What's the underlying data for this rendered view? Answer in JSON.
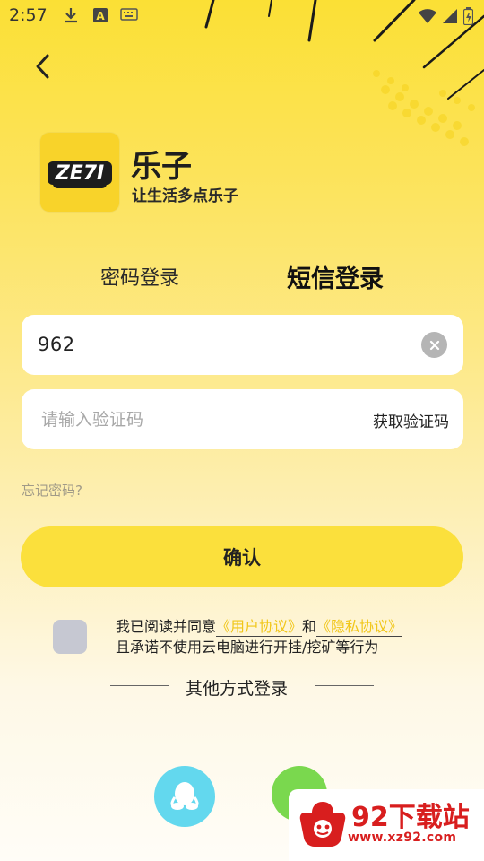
{
  "status_bar": {
    "time": "2:57",
    "icons": [
      "download-icon",
      "a-notification-icon",
      "keyboard-icon",
      "wifi-icon",
      "signal-icon",
      "battery-icon"
    ]
  },
  "header": {
    "back_icon": "back-arrow-icon"
  },
  "app": {
    "logo_text": "ZE7I",
    "name": "乐子",
    "slogan": "让生活多点乐子"
  },
  "tabs": [
    {
      "label": "密码登录",
      "active": false
    },
    {
      "label": "短信登录",
      "active": true
    }
  ],
  "phone": {
    "value": "962",
    "clear_icon": "clear-icon"
  },
  "code": {
    "placeholder": "请输入验证码",
    "get_code_label": "获取验证码"
  },
  "forgot_label": "忘记密码?",
  "confirm_label": "确认",
  "agreement": {
    "prefix": "我已阅读并同意",
    "user_agreement": "《用户协议》",
    "and": "和",
    "privacy_agreement": "《隐私协议》",
    "suffix": "且承诺不使用云电脑进行开挂/挖矿等行为"
  },
  "other_login": {
    "title": "其他方式登录",
    "providers": [
      "qq-icon",
      "wechat-icon"
    ]
  },
  "watermark": {
    "title": "92下载站",
    "url": "www.xz92.com"
  },
  "colors": {
    "brand_yellow": "#fbe03c",
    "link_yellow": "#f1c618",
    "qq_blue": "#63d8ee",
    "wechat_green": "#7ad84e",
    "watermark_red": "#d81e1e"
  }
}
